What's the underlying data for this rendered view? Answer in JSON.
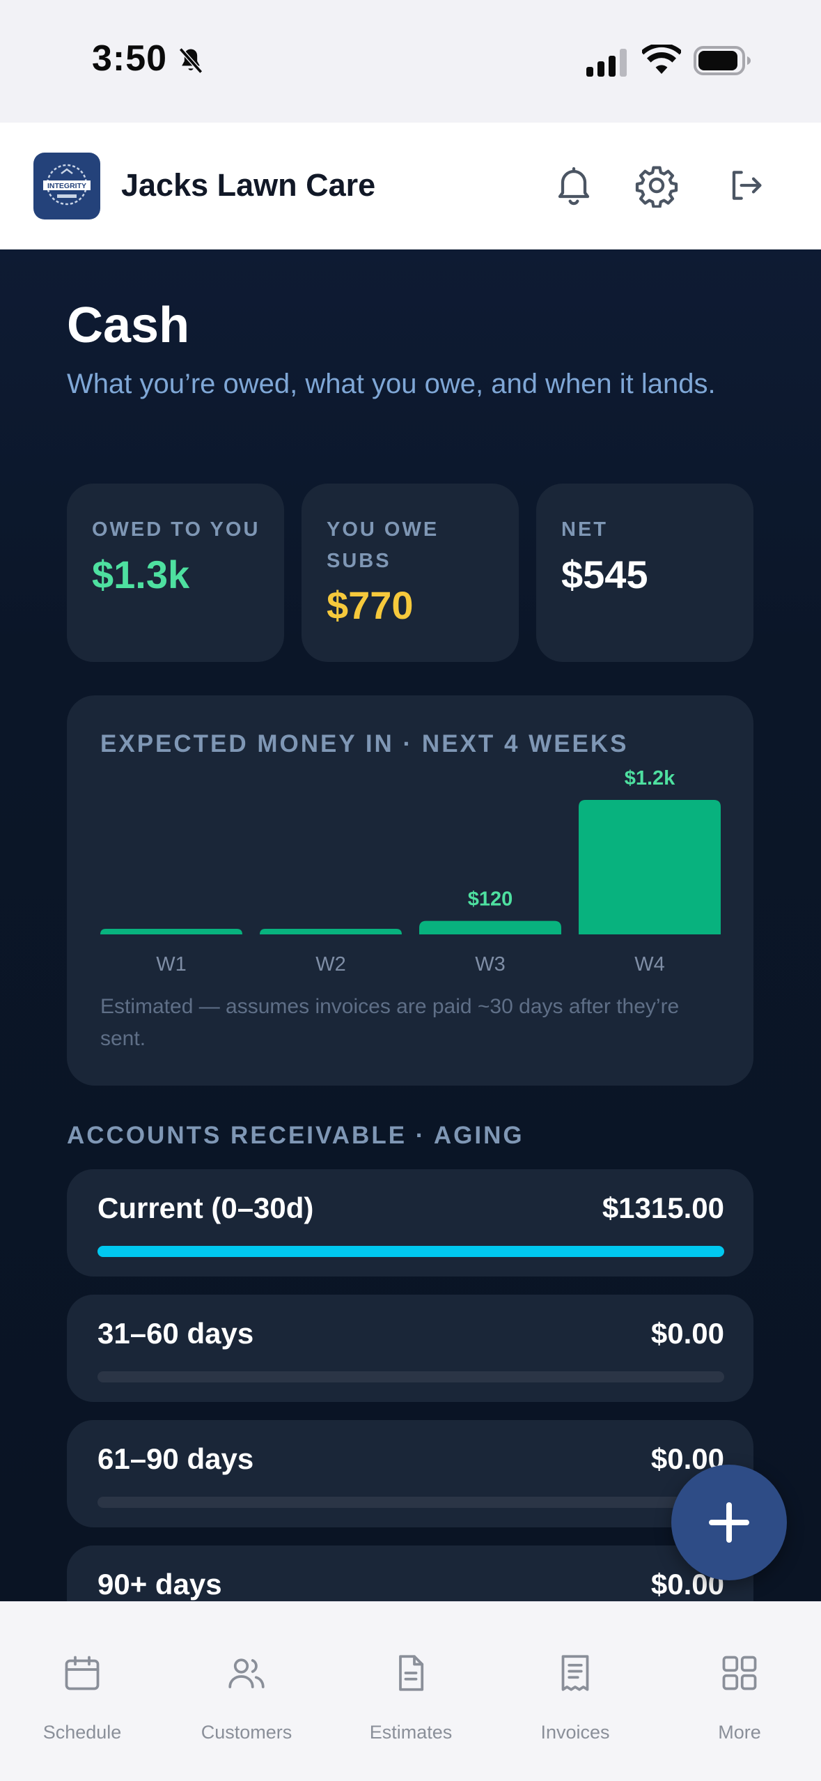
{
  "status_bar": {
    "time": "3:50"
  },
  "header": {
    "app_name": "Jacks Lawn Care",
    "logo_text": "INTEGRITY"
  },
  "page": {
    "title": "Cash",
    "subtitle": "What you’re owed, what you owe, and when it lands."
  },
  "stats": [
    {
      "label": "OWED TO YOU",
      "value": "$1.3k",
      "color": "#4ee0a0"
    },
    {
      "label": "YOU OWE SUBS",
      "value": "$770",
      "color": "#f6c93c"
    },
    {
      "label": "NET",
      "value": "$545",
      "color": "#ffffff"
    }
  ],
  "chart_data": {
    "type": "bar",
    "title": "EXPECTED MONEY IN · NEXT 4 WEEKS",
    "categories": [
      "W1",
      "W2",
      "W3",
      "W4"
    ],
    "values": [
      0,
      0,
      120,
      1195
    ],
    "data_labels": [
      "",
      "",
      "$120",
      "$1.2k"
    ],
    "ylim": [
      0,
      1195
    ],
    "color": "#08b27e",
    "note": "Estimated — assumes invoices are paid ~30 days after they’re sent."
  },
  "aging": {
    "title": "ACCOUNTS RECEIVABLE · AGING",
    "buckets": [
      {
        "label": "Current (0–30d)",
        "value": "$1315.00",
        "fraction": 1.0
      },
      {
        "label": "31–60 days",
        "value": "$0.00",
        "fraction": 0
      },
      {
        "label": "61–90 days",
        "value": "$0.00",
        "fraction": 0
      },
      {
        "label": "90+ days",
        "value": "$0.00",
        "fraction": 0
      }
    ]
  },
  "tabs": [
    {
      "label": "Schedule",
      "icon": "calendar-icon"
    },
    {
      "label": "Customers",
      "icon": "users-icon"
    },
    {
      "label": "Estimates",
      "icon": "document-icon"
    },
    {
      "label": "Invoices",
      "icon": "receipt-icon"
    },
    {
      "label": "More",
      "icon": "grid-icon"
    }
  ],
  "colors": {
    "accent": "#2e4c86",
    "aging_bar": "#00c8f0"
  }
}
